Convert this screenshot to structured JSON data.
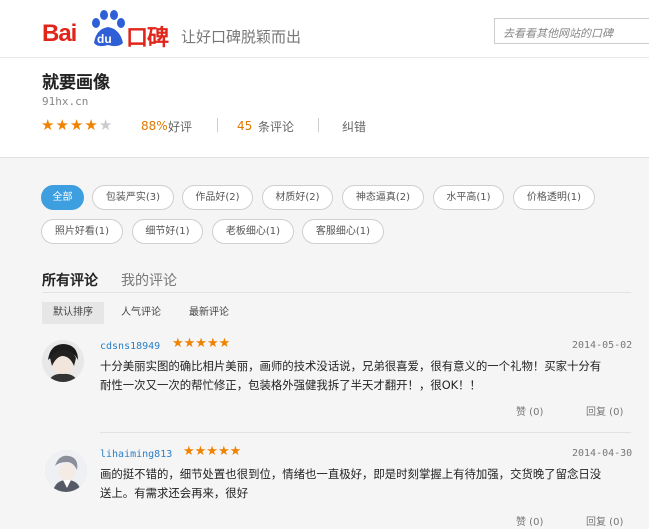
{
  "header": {
    "logo_bai": "Bai",
    "logo_du": "du",
    "logo_koubei": "口碑",
    "slogan": "让好口碑脱颖而出",
    "search_placeholder": "去看看其他网站的口碑"
  },
  "shop": {
    "title": "就要画像",
    "url": "91hx.cn",
    "rating_stars": 4,
    "rating_max": 5,
    "good_pct": "88%",
    "good_label": "好评",
    "review_count": "45",
    "review_label": "条评论",
    "report": "纠错"
  },
  "tags": [
    {
      "label": "全部",
      "active": true
    },
    {
      "label": "包装严实(3)",
      "active": false
    },
    {
      "label": "作品好(2)",
      "active": false
    },
    {
      "label": "材质好(2)",
      "active": false
    },
    {
      "label": "神态逼真(2)",
      "active": false
    },
    {
      "label": "水平高(1)",
      "active": false
    },
    {
      "label": "价格透明(1)",
      "active": false
    },
    {
      "label": "照片好看(1)",
      "active": false
    },
    {
      "label": "细节好(1)",
      "active": false
    },
    {
      "label": "老板细心(1)",
      "active": false
    },
    {
      "label": "客服细心(1)",
      "active": false
    }
  ],
  "tabs": {
    "all": "所有评论",
    "mine": "我的评论"
  },
  "sort": {
    "default": "默认排序",
    "popular": "人气评论",
    "latest": "最新评论"
  },
  "reviews": [
    {
      "user": "cdsns18949",
      "stars": 5,
      "date": "2014-05-02",
      "text_line1": "十分美丽实图的确比相片美丽，画师的技术没话说，兄弟很喜爱，很有意义的一个礼物！买家十分有",
      "text_line2": "耐性一次又一次的帮忙修正，包装格外强健我拆了半天才翻开！，很OK！！",
      "useful": "赞 (0)",
      "reply": "回复 (0)"
    },
    {
      "user": "lihaiming813",
      "stars": 5,
      "date": "2014-04-30",
      "text_line1": "画的挺不错的，细节处置也很到位，情绪也一直极好，即是时刻掌握上有待加强，交货晚了留念日没",
      "text_line2": "送上。有需求还会再来，很好",
      "useful": "赞 (0)",
      "reply": "回复 (0)"
    }
  ],
  "colors": {
    "brand_red": "#e1251b",
    "star_orange": "#f08200",
    "tag_active_blue": "#3d9ee0",
    "username_blue": "#2a7fc6"
  }
}
